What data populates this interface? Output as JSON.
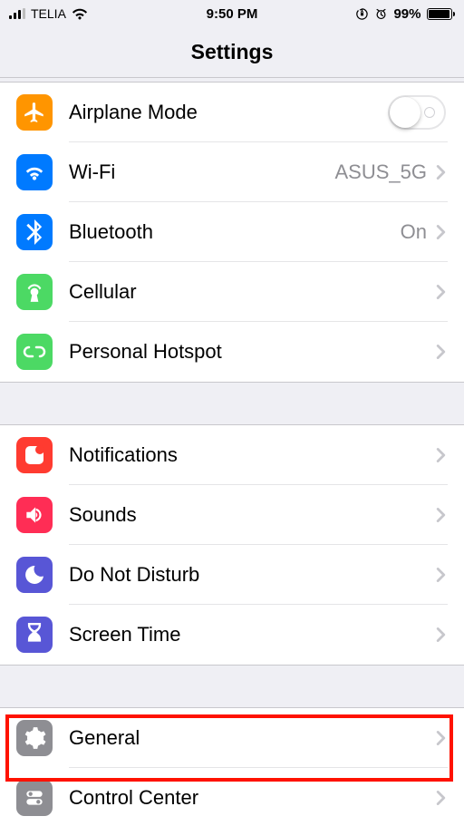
{
  "status": {
    "carrier": "TELIA",
    "time": "9:50 PM",
    "battery_pct": "99%"
  },
  "title": "Settings",
  "group1": {
    "airplane": {
      "label": "Airplane Mode",
      "state": "off"
    },
    "wifi": {
      "label": "Wi-Fi",
      "value": "ASUS_5G"
    },
    "bluetooth": {
      "label": "Bluetooth",
      "value": "On"
    },
    "cellular": {
      "label": "Cellular"
    },
    "hotspot": {
      "label": "Personal Hotspot"
    }
  },
  "group2": {
    "notifications": {
      "label": "Notifications"
    },
    "sounds": {
      "label": "Sounds"
    },
    "dnd": {
      "label": "Do Not Disturb"
    },
    "screentime": {
      "label": "Screen Time"
    }
  },
  "group3": {
    "general": {
      "label": "General",
      "highlighted": true
    },
    "controlcenter": {
      "label": "Control Center"
    }
  },
  "colors": {
    "orange": "#ff9500",
    "blue": "#007aff",
    "green": "#4cd964",
    "red": "#ff3b30",
    "pink": "#ff2d55",
    "purple": "#5856d6",
    "gray": "#8e8e93"
  }
}
